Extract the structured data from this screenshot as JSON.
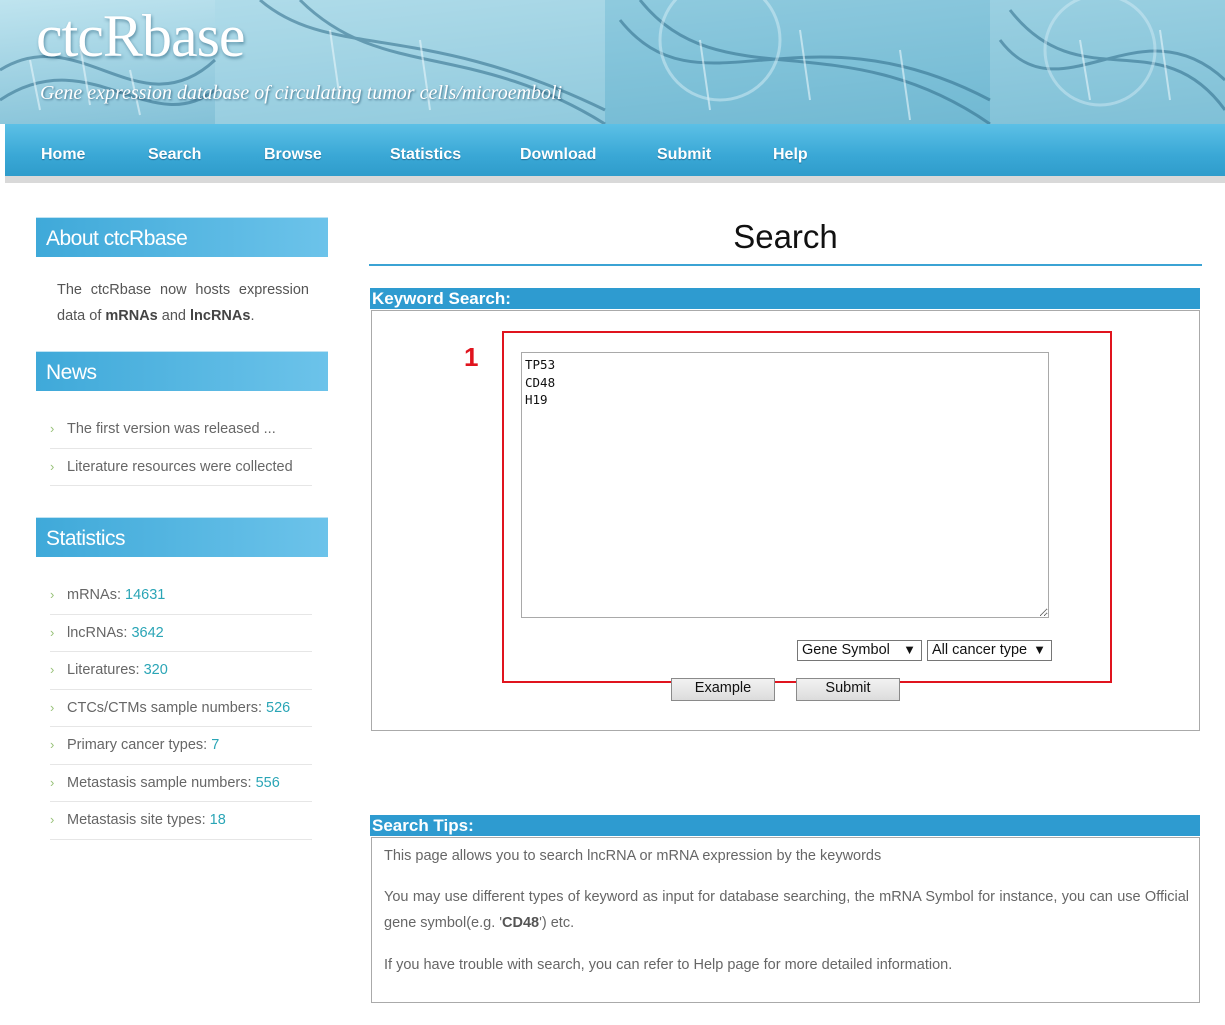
{
  "header": {
    "logo": "ctcRbase",
    "tagline": "Gene expression database of circulating tumor cells/microemboli"
  },
  "nav": [
    {
      "label": "Home"
    },
    {
      "label": "Search"
    },
    {
      "label": "Browse"
    },
    {
      "label": "Statistics"
    },
    {
      "label": "Download"
    },
    {
      "label": "Submit"
    },
    {
      "label": "Help"
    }
  ],
  "sidebar": {
    "about": {
      "title": "About ctcRbase",
      "text_before": "The ctcRbase now hosts expression data of ",
      "bold1": "mRNAs",
      "text_mid": " and ",
      "bold2": "lncRNAs",
      "text_after": "."
    },
    "news": {
      "title": "News",
      "items": [
        "The first version was released ...",
        "Literature resources were collected"
      ]
    },
    "statistics": {
      "title": "Statistics",
      "items": [
        {
          "label": "mRNAs: ",
          "value": "14631"
        },
        {
          "label": "lncRNAs: ",
          "value": "3642"
        },
        {
          "label": "Literatures: ",
          "value": "320"
        },
        {
          "label": "CTCs/CTMs sample numbers: ",
          "value": "526"
        },
        {
          "label": "Primary cancer types: ",
          "value": "7"
        },
        {
          "label": "Metastasis sample numbers: ",
          "value": "556"
        },
        {
          "label": "Metastasis site types: ",
          "value": "18"
        }
      ]
    }
  },
  "main": {
    "title": "Search",
    "keyword_search": {
      "heading": "Keyword Search:",
      "annotation_number": "1",
      "textarea_value": "TP53\nCD48\nH19",
      "select_type": "Gene Symbol",
      "select_cancer": "All cancer type",
      "example_label": "Example",
      "submit_label": "Submit"
    },
    "tips": {
      "heading": "Search Tips:",
      "p1": "This page allows you to search lncRNA or mRNA expression by the keywords",
      "p2_before": "You may use different types of keyword as input for database searching, the mRNA Symbol for instance, you can use Official gene symbol(e.g. '",
      "p2_bold": "CD48",
      "p2_after": "') etc.",
      "p3": "If you have trouble with search, you can refer to Help page for more detailed information."
    }
  },
  "colors": {
    "nav_blue": "#3aa8d6",
    "section_blue": "#2e9bd0",
    "annotation_red": "#e0141e",
    "stat_value": "#2aa5b6"
  }
}
